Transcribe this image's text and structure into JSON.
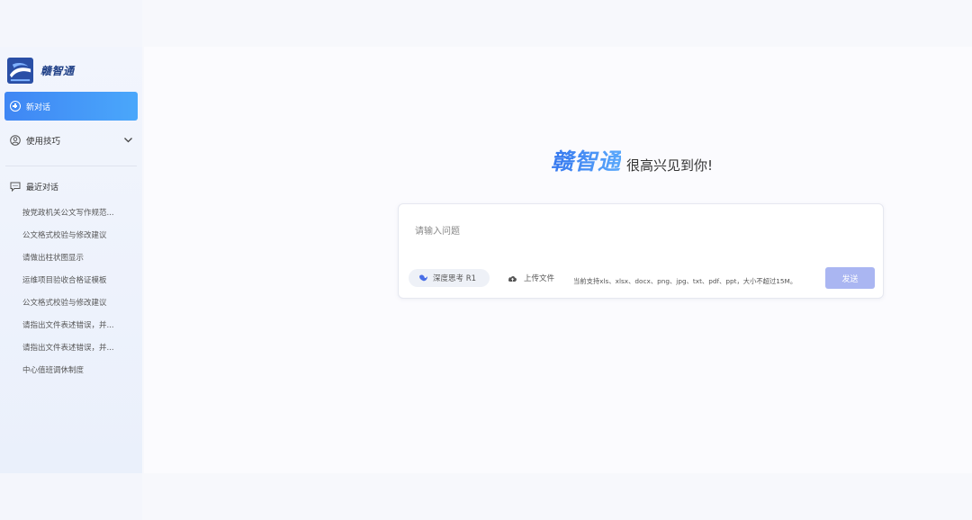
{
  "brand": {
    "name": "赣智通"
  },
  "sidebar": {
    "new_chat_label": "新对话",
    "tips_label": "使用技巧",
    "recent_title": "最近对话",
    "recent_items": [
      "按党政机关公文写作规范...",
      "公文格式校验与修改建议",
      "请做出柱状图显示",
      "运维项目验收合格证模板",
      "公文格式校验与修改建议",
      "请指出文件表述错误，并...",
      "请指出文件表述错误，并...",
      "中心值班调休制度"
    ]
  },
  "main": {
    "welcome_brand": "赣智通",
    "welcome_text": "很高兴见到你!",
    "input_placeholder": "请输入问题",
    "deep_think_label": "深度思考 R1",
    "upload_label": "上传文件",
    "support_text": "当前支持xls、xlsx、docx、png、jpg、txt、pdf、ppt，大小不超过15M。",
    "send_label": "发送"
  },
  "colors": {
    "accent": "#3f86f4",
    "send_disabled": "#aab6f2",
    "brand_dark": "#1f3f86"
  },
  "icons": {
    "logo": "logo-icon",
    "new_chat": "plus-circle-icon",
    "tips": "user-circle-icon",
    "tips_chevron": "chevron-down-icon",
    "recent": "chat-bubble-icon",
    "deep_think": "deep-think-icon",
    "upload": "cloud-upload-icon"
  }
}
